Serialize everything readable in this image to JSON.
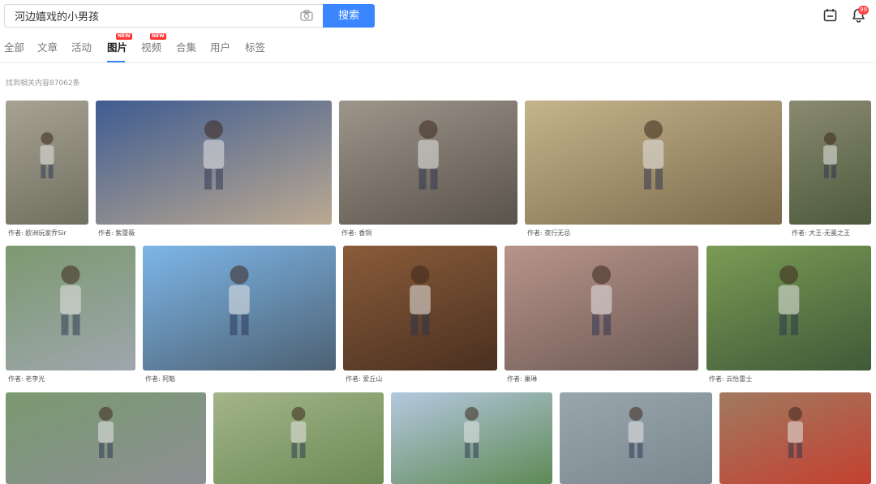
{
  "search": {
    "query": "河边嬉戏的小男孩",
    "button_label": "搜索"
  },
  "notifications": {
    "count": "99"
  },
  "tabs": [
    {
      "label": "全部",
      "active": false,
      "new": false
    },
    {
      "label": "文章",
      "active": false,
      "new": false
    },
    {
      "label": "活动",
      "active": false,
      "new": false
    },
    {
      "label": "图片",
      "active": true,
      "new": true
    },
    {
      "label": "视频",
      "active": false,
      "new": true
    },
    {
      "label": "合集",
      "active": false,
      "new": false
    },
    {
      "label": "用户",
      "active": false,
      "new": false
    },
    {
      "label": "标签",
      "active": false,
      "new": false
    }
  ],
  "new_badge": "NEW",
  "result_count": "找到相关内容87062条",
  "images": [
    {
      "author": "作者: 欧洲玩家乔Sir",
      "palette": [
        "#a7a294",
        "#707060"
      ]
    },
    {
      "author": "作者: 紫蕾薇",
      "palette": [
        "#3f5c91",
        "#bba991"
      ]
    },
    {
      "author": "作者: 香铜",
      "palette": [
        "#9e958b",
        "#5a534b"
      ]
    },
    {
      "author": "作者: 夜行无忌",
      "palette": [
        "#c4b58d",
        "#7b6a4a"
      ]
    },
    {
      "author": "作者: 大王-无冕之王",
      "palette": [
        "#8a8a70",
        "#4d5a3d"
      ]
    },
    {
      "author": "作者: 老李光",
      "palette": [
        "#7d9970",
        "#9ea6ad"
      ]
    },
    {
      "author": "作者: 阿魁",
      "palette": [
        "#7db6e8",
        "#4d6173"
      ]
    },
    {
      "author": "作者: 爱丘山",
      "palette": [
        "#8a5c3a",
        "#4a3020"
      ]
    },
    {
      "author": "作者: 巢琳",
      "palette": [
        "#b8948a",
        "#6d5a55"
      ]
    },
    {
      "author": "作者: 云怡雷士",
      "palette": [
        "#7a9c55",
        "#3f5a38"
      ]
    },
    {
      "author": "",
      "palette": [
        "#7a9a70",
        "#8c8f93"
      ]
    },
    {
      "author": "",
      "palette": [
        "#a3b58a",
        "#6d8a55"
      ]
    },
    {
      "author": "",
      "palette": [
        "#b5c8e0",
        "#5f8a55"
      ]
    },
    {
      "author": "",
      "palette": [
        "#9aa6ad",
        "#7a8890"
      ]
    },
    {
      "author": "",
      "palette": [
        "#a07a60",
        "#c44030"
      ]
    }
  ]
}
